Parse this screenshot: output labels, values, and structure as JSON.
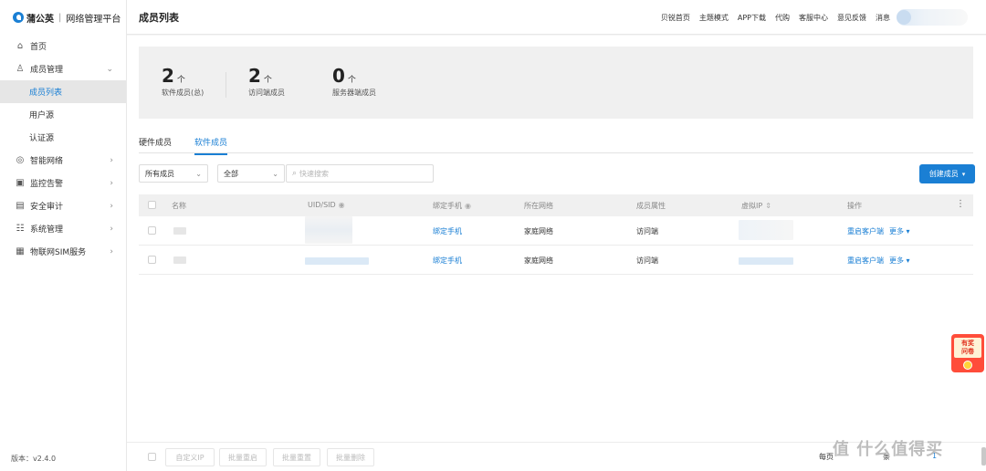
{
  "app": {
    "brand": "蒲公英",
    "platform": "网络管理平台",
    "version": "版本：v2.4.0"
  },
  "sidebar": {
    "items": [
      {
        "label": "首页",
        "icon": "home-icon"
      },
      {
        "label": "成员管理",
        "icon": "user-icon",
        "expanded": true,
        "children": [
          {
            "label": "成员列表",
            "active": true
          },
          {
            "label": "用户源"
          },
          {
            "label": "认证源"
          }
        ]
      },
      {
        "label": "智能网络",
        "icon": "network-icon"
      },
      {
        "label": "监控告警",
        "icon": "monitor-icon"
      },
      {
        "label": "安全审计",
        "icon": "audit-icon"
      },
      {
        "label": "系统管理",
        "icon": "settings-icon"
      },
      {
        "label": "物联网SIM服务",
        "icon": "sim-icon"
      }
    ]
  },
  "header": {
    "title": "成员列表",
    "links": [
      "贝锐首页",
      "主题模式",
      "APP下载",
      "代购",
      "客服中心",
      "意见反馈",
      "消息"
    ]
  },
  "stats": [
    {
      "value": "2",
      "unit": "个",
      "label": "软件成员(总)"
    },
    {
      "value": "2",
      "unit": "个",
      "label": "访问端成员"
    },
    {
      "value": "0",
      "unit": "个",
      "label": "服务器端成员"
    }
  ],
  "tabs": [
    {
      "label": "硬件成员",
      "active": false
    },
    {
      "label": "软件成员",
      "active": true
    }
  ],
  "filters": {
    "member_type": "所有成员",
    "scope": "全部",
    "search_placeholder": "快速搜索"
  },
  "create_button": "创建成员",
  "table": {
    "columns": [
      "名称",
      "UID/SID",
      "绑定手机",
      "所在网络",
      "成员属性",
      "虚拟IP",
      "操作"
    ],
    "rows": [
      {
        "phone": "绑定手机",
        "network": "家庭网络",
        "attribute": "访问端",
        "action": "重启客户端",
        "more": "更多"
      },
      {
        "phone": "绑定手机",
        "network": "家庭网络",
        "attribute": "访问端",
        "action": "重启客户端",
        "more": "更多"
      }
    ]
  },
  "bulk_actions": [
    "自定义IP",
    "批量重启",
    "批量重置",
    "批量删除"
  ],
  "pagination": {
    "per_page_label": "每页",
    "total_suffix": "条",
    "current_page": "1"
  },
  "survey": {
    "line1": "有奖",
    "line2": "问卷"
  },
  "watermark": "值 什么值得买",
  "colors": {
    "accent": "#1a7fd4",
    "survey": "#ff4d3a"
  }
}
